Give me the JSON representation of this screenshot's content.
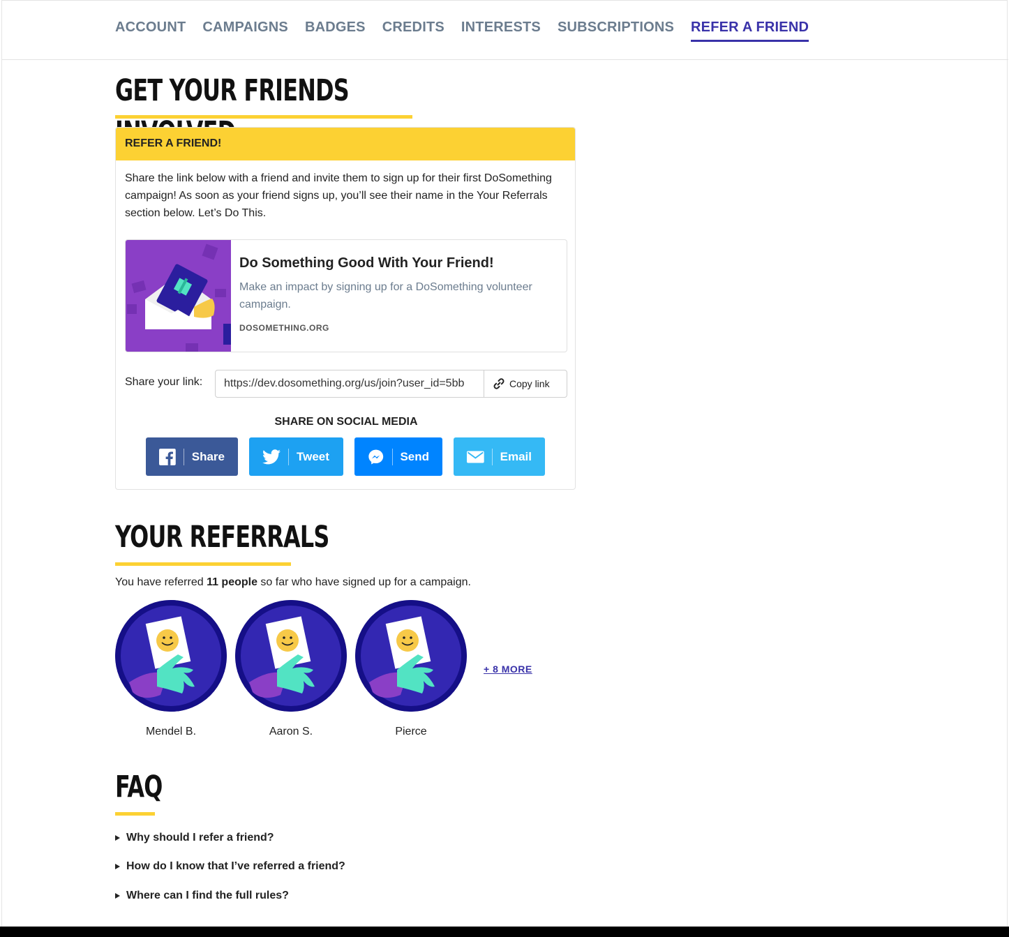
{
  "nav": {
    "tabs": [
      {
        "label": "ACCOUNT"
      },
      {
        "label": "CAMPAIGNS"
      },
      {
        "label": "BADGES"
      },
      {
        "label": "CREDITS"
      },
      {
        "label": "INTERESTS"
      },
      {
        "label": "SUBSCRIPTIONS"
      },
      {
        "label": "REFER A FRIEND"
      }
    ],
    "active_tab": "REFER A FRIEND"
  },
  "heading_involved": "GET YOUR FRIENDS INVOLVED",
  "refer_card": {
    "header": "REFER A FRIEND!",
    "body": "Share the link below with a friend and invite them to sign up for their first DoSomething campaign! As soon as your friend signs up, you’ll see their name in the Your Referrals section below. Let’s Do This.",
    "preview": {
      "title": "Do Something Good With Your Friend!",
      "description": "Make an impact by signing up for a DoSomething volunteer campaign.",
      "domain": "DOSOMETHING.ORG"
    },
    "share_link_label": "Share your link:",
    "share_link_value": "https://dev.dosomething.org/us/join?user_id=5bb",
    "copy_label": "Copy link",
    "social_title": "SHARE ON SOCIAL MEDIA",
    "social_buttons": {
      "facebook": "Share",
      "twitter": "Tweet",
      "messenger": "Send",
      "email": "Email"
    }
  },
  "referrals": {
    "heading": "YOUR REFERRALS",
    "text_prefix": "You have referred ",
    "count_text": "11 people",
    "text_suffix": " so far who have signed up for a campaign.",
    "people": [
      {
        "name": "Mendel B."
      },
      {
        "name": "Aaron S."
      },
      {
        "name": "Pierce"
      }
    ],
    "more_label": "+ 8 MORE"
  },
  "faq": {
    "heading": "FAQ",
    "items": [
      {
        "question": "Why should I refer a friend?"
      },
      {
        "question": "How do I know that I’ve referred a friend?"
      },
      {
        "question": "Where can I find the full rules?"
      }
    ]
  },
  "colors": {
    "accent": "#3932a9",
    "highlight": "#fcd133",
    "facebook": "#3b5998",
    "twitter": "#1da1f2",
    "messenger": "#0084ff",
    "email": "#35b9f5"
  }
}
